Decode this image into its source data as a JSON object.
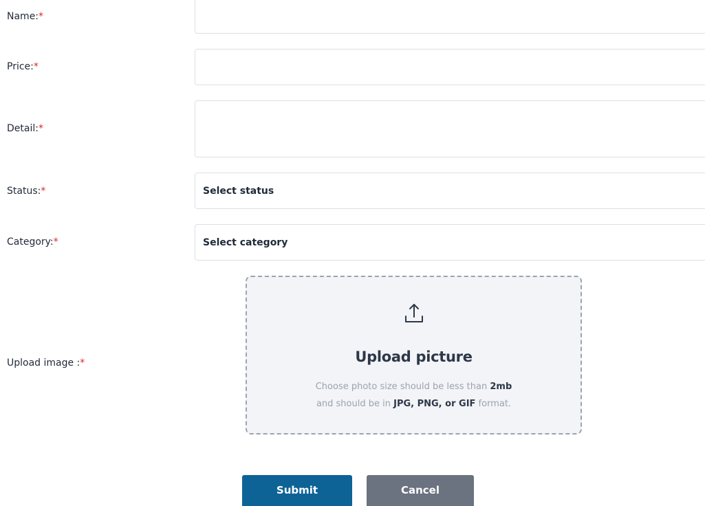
{
  "form": {
    "fields": [
      {
        "label": "Name:",
        "required": "*",
        "value": "",
        "placeholder": ""
      },
      {
        "label": "Price:",
        "required": "*",
        "value": "",
        "placeholder": ""
      },
      {
        "label": "Detail:",
        "required": "*",
        "value": "",
        "placeholder": ""
      },
      {
        "label": "Status:",
        "required": "*",
        "selected": "Select status"
      },
      {
        "label": "Category:",
        "required": "*",
        "selected": "Select category"
      },
      {
        "label": "Upload image :",
        "required": "*"
      }
    ],
    "upload": {
      "icon": "upload-icon",
      "title": "Upload picture",
      "desc_line1_prefix": "Choose photo size should be less than ",
      "desc_line1_bold": "2mb",
      "desc_line2_prefix": "and should be in ",
      "desc_line2_bold": "JPG, PNG, or GIF",
      "desc_line2_suffix": " format."
    },
    "buttons": {
      "submit": "Submit",
      "cancel": "Cancel"
    }
  },
  "colors": {
    "required": "#dc2626",
    "submit_bg": "#0d6396",
    "cancel_bg": "#6b7280",
    "border": "#dcdfe4",
    "upload_bg": "#f2f4f7"
  }
}
